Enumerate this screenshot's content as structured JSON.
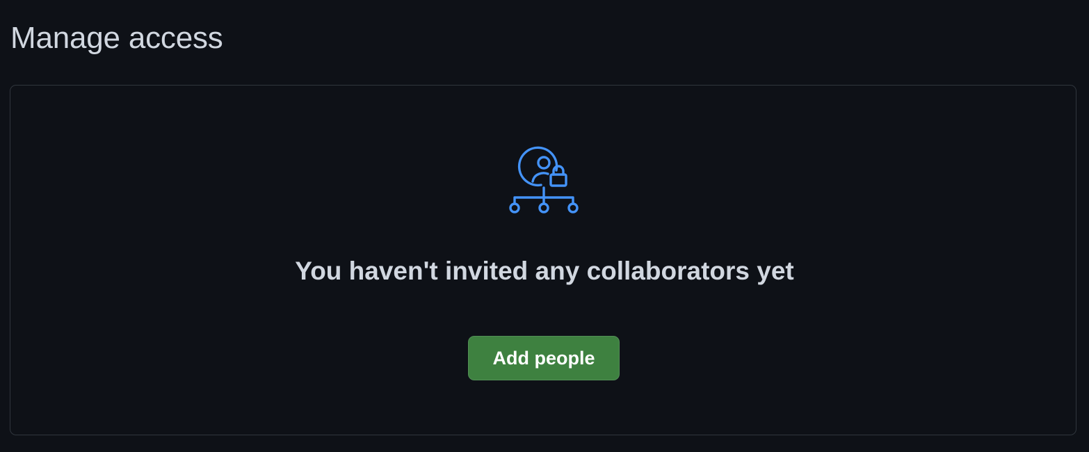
{
  "page": {
    "title": "Manage access"
  },
  "empty_state": {
    "icon": "person-lock-network-icon",
    "message": "You haven't invited any collaborators yet",
    "button_label": "Add people"
  },
  "colors": {
    "background": "#0e1117",
    "panel_border": "#30363d",
    "text_primary": "#d1d7e0",
    "icon_accent": "#4493f8",
    "button_bg": "#3e8140",
    "button_text": "#ffffff"
  }
}
